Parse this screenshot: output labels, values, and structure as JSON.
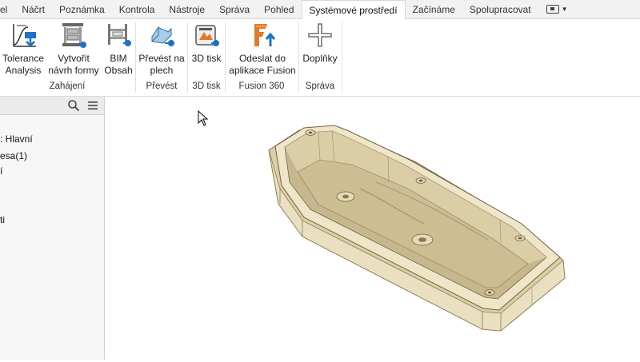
{
  "menu_tabs": [
    {
      "label": "el"
    },
    {
      "label": "Náčrt"
    },
    {
      "label": "Poznámka"
    },
    {
      "label": "Kontrola"
    },
    {
      "label": "Nástroje"
    },
    {
      "label": "Správa"
    },
    {
      "label": "Pohled"
    },
    {
      "label": "Systémové prostředí",
      "active": true
    },
    {
      "label": "Začínáme"
    },
    {
      "label": "Spolupracovat"
    }
  ],
  "ribbon": {
    "groups": {
      "zahajeni": "Zahájení",
      "prevest": "Převést",
      "tisk3d": "3D tisk",
      "fusion": "Fusion 360",
      "sprava": "Správa"
    },
    "buttons": {
      "tolerance_l1": "Tolerance",
      "tolerance_l2": "Analysis",
      "mold_l1": "Vytvořit",
      "mold_l2": "návrh formy",
      "bim_l1": "BIM",
      "bim_l2": "Obsah",
      "sheet_l1": "Převést na",
      "sheet_l2": "plech",
      "print3d": "3D tisk",
      "fusion_l1": "Odeslat do",
      "fusion_l2": "aplikace Fusion",
      "addins": "Doplňky"
    }
  },
  "browser": {
    "items": [
      ":  Hlavní",
      "esa(1)",
      "í",
      "ti"
    ]
  },
  "icons": {
    "search": "search-icon",
    "menu": "hamburger-menu-icon",
    "cursor": "mouse-pointer-icon"
  },
  "colors": {
    "accent_blue": "#1a73c9",
    "part_body": "#e8dcbc",
    "fusion_orange": "#e07b25"
  }
}
